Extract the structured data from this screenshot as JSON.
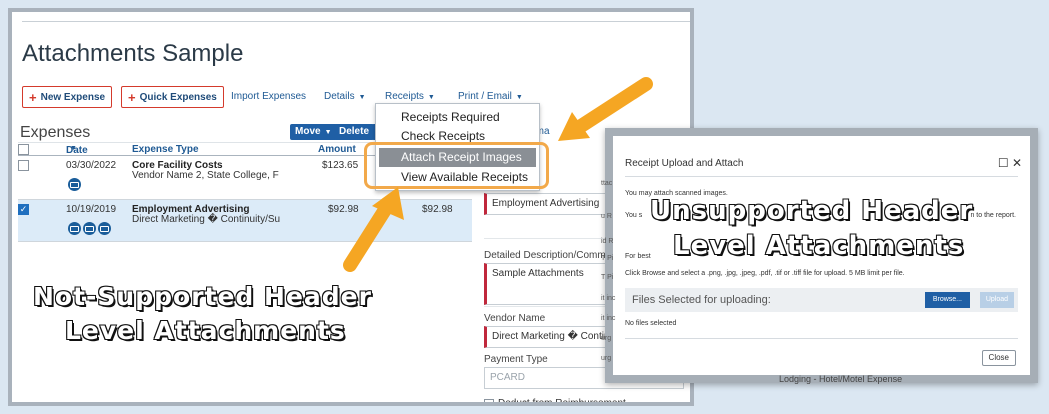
{
  "page_title": "Attachments Sample",
  "toolbar": {
    "new_expense": "New Expense",
    "quick_expenses": "Quick Expenses",
    "import_expenses": "Import Expenses",
    "details": "Details",
    "receipts": "Receipts",
    "print_email": "Print / Email"
  },
  "expenses": {
    "label": "Expenses",
    "move_btn": "Move",
    "delete_btn": "Delete",
    "columns": {
      "date": "Date",
      "type": "Expense Type",
      "amount": "Amount"
    },
    "rows": [
      {
        "date": "03/30/2022",
        "type": "Core Facility Costs",
        "sub": "Vendor Name 2, State College, F",
        "amount": "$123.65",
        "requested": "",
        "checked": false
      },
      {
        "date": "10/19/2019",
        "type": "Employment Advertising",
        "sub": "Direct Marketing � Continuity/Su",
        "amount": "$92.98",
        "requested": "$92.98",
        "checked": true
      }
    ]
  },
  "receipts_menu": {
    "items": [
      "Receipts Required",
      "Check Receipts",
      "Attach Receipt Images",
      "View Available Receipts"
    ],
    "highlighted": "Attach Receipt Images"
  },
  "form": {
    "tab_fragment": "eipt Ima",
    "expense_type_value": "Employment Advertising",
    "desc_label": "Detailed Description/Comment",
    "desc_value": "Sample Attachments",
    "vendor_label": "Vendor Name",
    "vendor_value": "Direct Marketing � Continuity",
    "payment_label": "Payment Type",
    "payment_value": "PCARD",
    "deduct_label": "Deduct from Reimbursement"
  },
  "modal": {
    "title": "Receipt Upload and Attach",
    "line1": "You may attach scanned images.",
    "line2_start": "You s",
    "line2_end": "n to the report.",
    "line3_start": "For best",
    "line4": "Click Browse and select a .png, .jpg, .jpeg, .pdf, .tif or .tiff file for upload. 5 MB limit per file.",
    "files_label": "Files Selected for uploading:",
    "browse": "Browse...",
    "upload": "Upload",
    "no_files": "No files selected",
    "close": "Close",
    "behind_text": "Lodging - Hotel/Motel Expense",
    "side_fragments": [
      "ttac",
      "u R",
      "id R",
      "T Pi",
      "T Pi",
      "it inc",
      "it inc",
      "urg",
      "urg"
    ]
  },
  "callouts": {
    "left_line1": "Not-Supported Header",
    "left_line2": "Level Attachments",
    "right_line1": "Unsupported Header",
    "right_line2": "Level Attachments"
  },
  "colors": {
    "accent_red": "#d43a2c",
    "link_blue": "#1f5a94",
    "primary_button": "#1f5fa5",
    "highlight_orange": "#f2a94a",
    "arrow_orange": "#f5a623"
  }
}
